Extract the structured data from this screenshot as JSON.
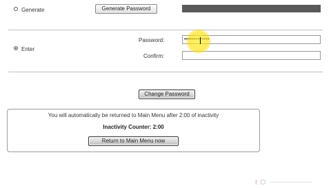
{
  "generate_section": {
    "radio_label": "Generate",
    "generate_button": "Generate Password"
  },
  "enter_section": {
    "radio_label": "Enter",
    "password_label": "Password:",
    "password_value": "•••••••••••••",
    "confirm_label": "Confirm:",
    "confirm_value": ""
  },
  "change_button": "Change Password",
  "inactivity": {
    "message": "You will automatically be returned to Main Menu after 2:00 of inactivity",
    "counter": "Inactivity Counter: 2:00",
    "return_button": "Return to Main Menu now"
  },
  "colors": {
    "generated_bar": "#595959",
    "highlight": "#ffe100"
  }
}
